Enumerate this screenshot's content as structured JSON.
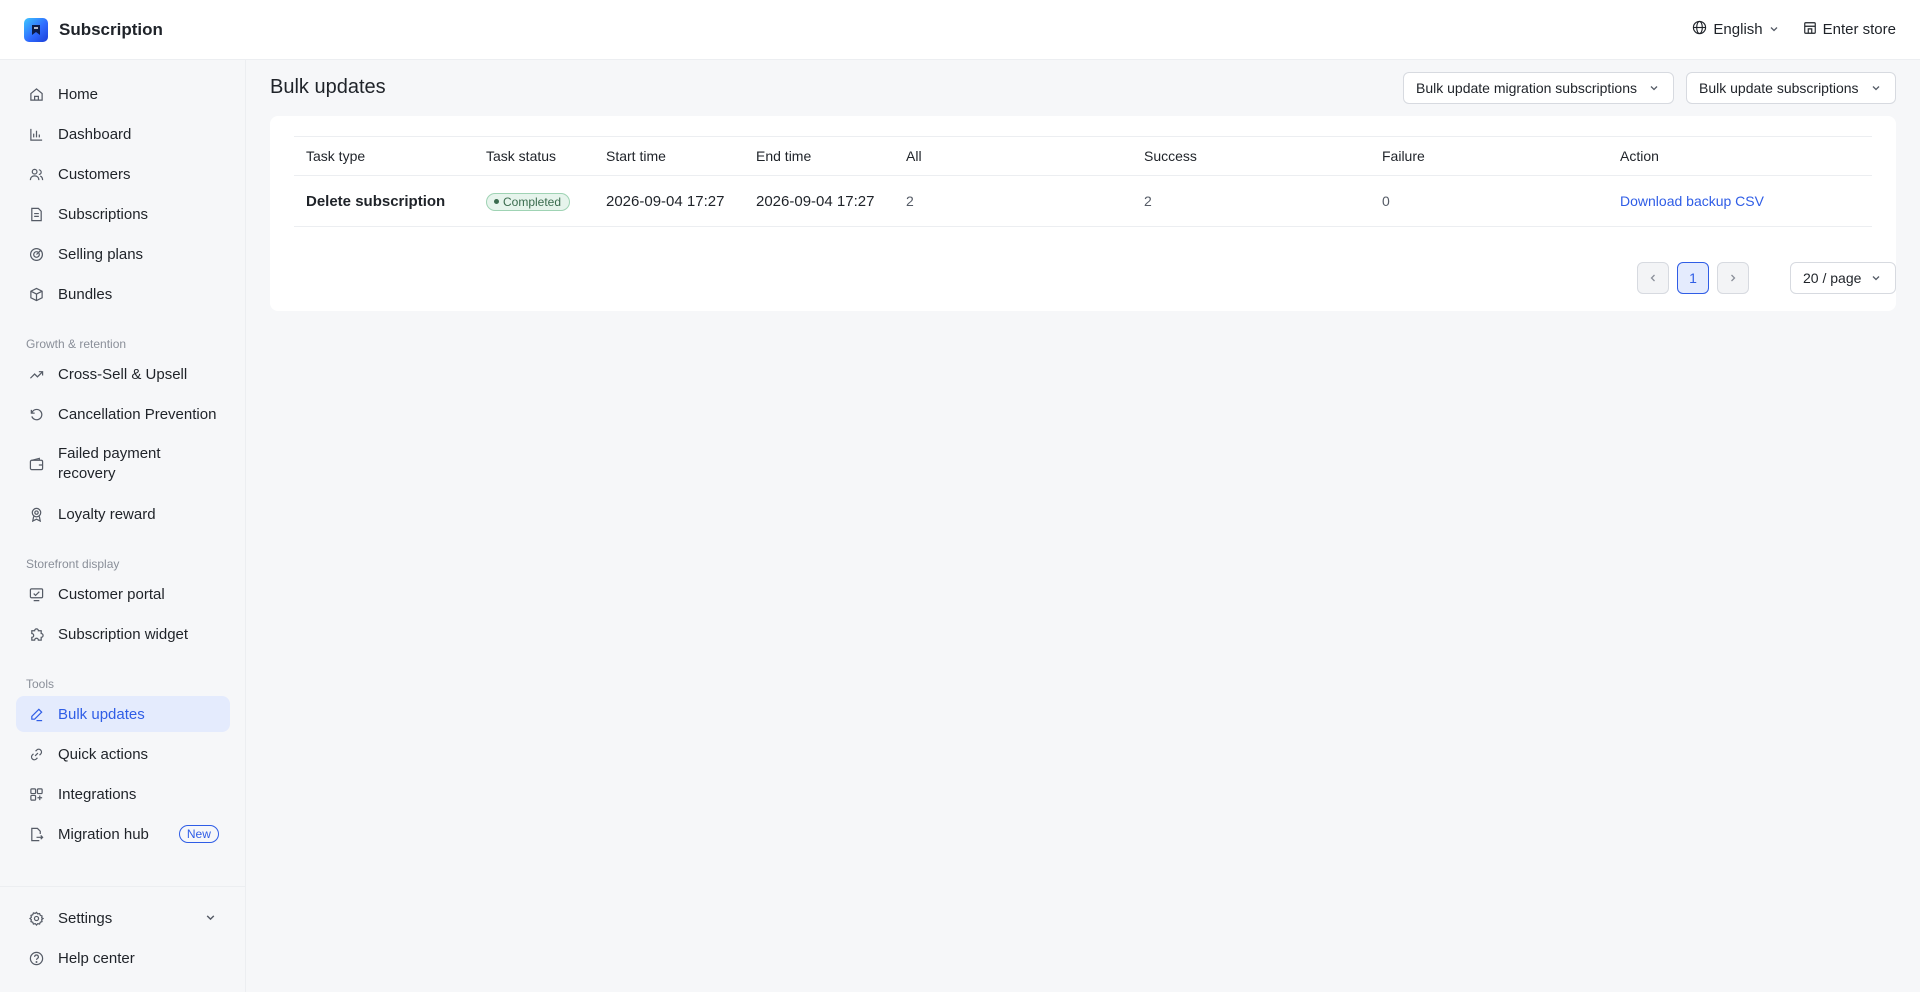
{
  "app": {
    "title": "Subscription"
  },
  "header": {
    "language": "English",
    "enter_store": "Enter store"
  },
  "sidebar": {
    "main_items": [
      {
        "label": "Home"
      },
      {
        "label": "Dashboard"
      },
      {
        "label": "Customers"
      },
      {
        "label": "Subscriptions"
      },
      {
        "label": "Selling plans"
      },
      {
        "label": "Bundles"
      }
    ],
    "growth_label": "Growth & retention",
    "growth_items": [
      {
        "label": "Cross-Sell & Upsell"
      },
      {
        "label": "Cancellation Prevention"
      },
      {
        "label": "Failed payment recovery"
      },
      {
        "label": "Loyalty reward"
      }
    ],
    "storefront_label": "Storefront display",
    "storefront_items": [
      {
        "label": "Customer portal"
      },
      {
        "label": "Subscription widget"
      }
    ],
    "tools_label": "Tools",
    "tools_items": [
      {
        "label": "Bulk updates",
        "active": true
      },
      {
        "label": "Quick actions"
      },
      {
        "label": "Integrations"
      },
      {
        "label": "Migration hub",
        "badge": "New"
      }
    ],
    "bottom_items": [
      {
        "label": "Settings"
      },
      {
        "label": "Help center"
      }
    ]
  },
  "main": {
    "title": "Bulk updates",
    "btn_migration": "Bulk update migration subscriptions",
    "btn_bulk": "Bulk update subscriptions",
    "table": {
      "columns": [
        "Task type",
        "Task status",
        "Start time",
        "End time",
        "All",
        "Success",
        "Failure",
        "Action"
      ],
      "rows": [
        {
          "task_type": "Delete subscription",
          "status": "Completed",
          "start": "2026-09-04 17:27",
          "end": "2026-09-04 17:27",
          "all": "2",
          "success": "2",
          "failure": "0",
          "action": "Download backup CSV"
        }
      ]
    },
    "pagination": {
      "current_page": "1",
      "page_size": "20 / page"
    }
  },
  "colors": {
    "accent": "#2f5de6",
    "active_bg": "#e4ebfd",
    "success_bg": "#e6f4ec"
  }
}
